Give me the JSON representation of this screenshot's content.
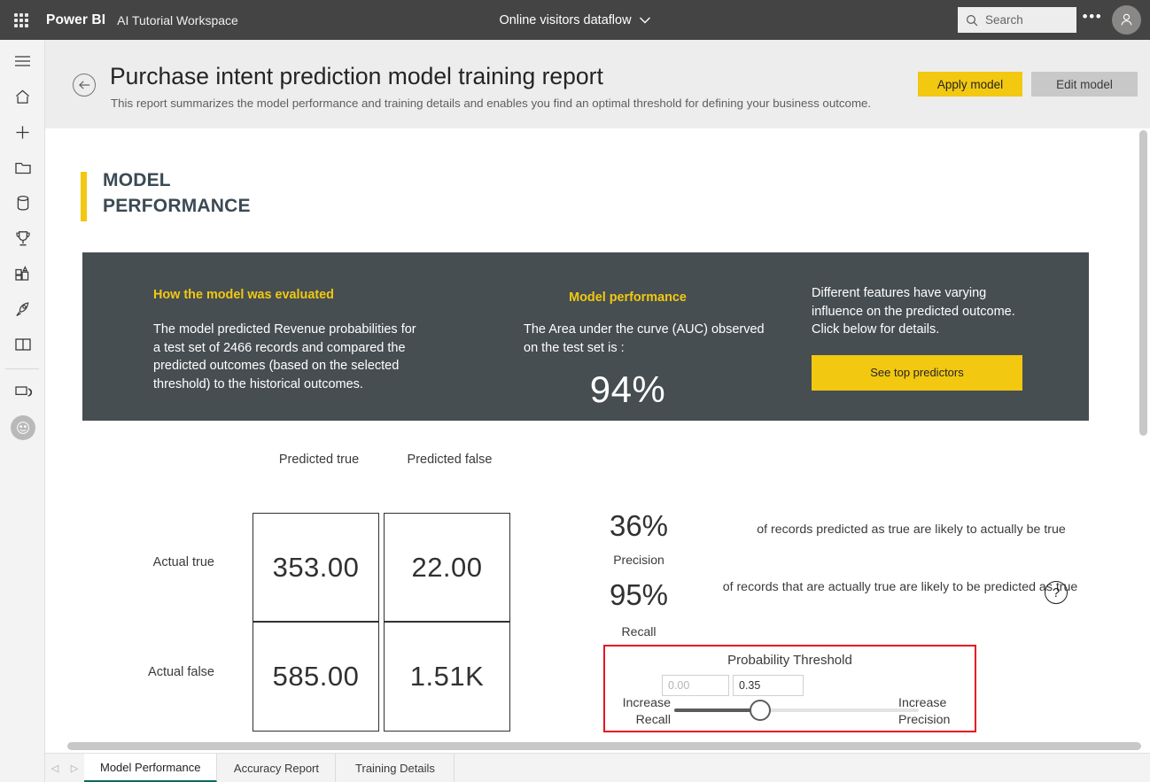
{
  "topbar": {
    "waffle_label": "app-launcher",
    "brand": "Power BI",
    "workspace": "AI Tutorial Workspace",
    "dataflow": "Online visitors dataflow",
    "search_placeholder": "Search",
    "ellipsis": "•••"
  },
  "leftnav": {
    "items": [
      {
        "name": "nav-menu",
        "icon": "hamburger-icon"
      },
      {
        "name": "nav-home",
        "icon": "home-icon"
      },
      {
        "name": "nav-create",
        "icon": "plus-icon"
      },
      {
        "name": "nav-browse",
        "icon": "folder-icon"
      },
      {
        "name": "nav-data-hub",
        "icon": "database-icon"
      },
      {
        "name": "nav-metrics",
        "icon": "trophy-icon"
      },
      {
        "name": "nav-apps",
        "icon": "apps-grid-icon"
      },
      {
        "name": "nav-deployment-pipelines",
        "icon": "rocket-icon"
      },
      {
        "name": "nav-learn",
        "icon": "book-icon"
      },
      {
        "name": "nav-workspaces",
        "icon": "layers-icon"
      },
      {
        "name": "nav-current-workspace",
        "icon": "workspace-avatar-icon"
      }
    ]
  },
  "report": {
    "title": "Purchase intent prediction model training report",
    "subtitle": "This report summarizes the model performance and training details and enables you find an optimal threshold for defining your business outcome.",
    "apply_button": "Apply model",
    "edit_button": "Edit model"
  },
  "section": {
    "title_line1": "MODEL",
    "title_line2": "PERFORMANCE"
  },
  "info_panel": {
    "evaluated": {
      "heading": "How the model was evaluated",
      "body": "The model predicted Revenue probabilities for a test set of 2466 records and compared the predicted outcomes (based on the selected threshold) to the historical outcomes."
    },
    "performance": {
      "heading": "Model performance",
      "body": "The Area under the curve (AUC) observed on the test set is :",
      "auc": "94%"
    },
    "predictors": {
      "body": "Different features have varying influence on the predicted outcome.  Click below for details.",
      "button": "See top predictors"
    }
  },
  "confusion_matrix": {
    "col_headers": [
      "Predicted true",
      "Predicted false"
    ],
    "row_headers": [
      "Actual true",
      "Actual false"
    ],
    "cells": [
      [
        "353.00",
        "22.00"
      ],
      [
        "585.00",
        "1.51K"
      ]
    ]
  },
  "metrics": {
    "precision": {
      "value": "36%",
      "label": "Precision",
      "description": "of records predicted as true are likely to actually be true"
    },
    "recall": {
      "value": "95%",
      "label": "Recall",
      "description": "of records that are actually true are likely to be predicted as true"
    }
  },
  "threshold": {
    "title": "Probability Threshold",
    "min_value": "0.00",
    "max_value": "0.35",
    "left_label_line1": "Increase",
    "left_label_line2": "Recall",
    "right_label_line1": "Increase",
    "right_label_line2": "Precision",
    "slider_percent": 35,
    "highlight_color": "#e81123"
  },
  "help": {
    "glyph": "?"
  },
  "tabs": {
    "prev": "◁",
    "next": "▷",
    "items": [
      {
        "label": "Model Performance",
        "active": true
      },
      {
        "label": "Accuracy Report",
        "active": false
      },
      {
        "label": "Training Details",
        "active": false
      }
    ]
  },
  "colors": {
    "brand_yellow": "#f2c811",
    "panel_dark": "#464e51",
    "topbar_dark": "#444444",
    "tab_accent": "#0b6a62"
  }
}
